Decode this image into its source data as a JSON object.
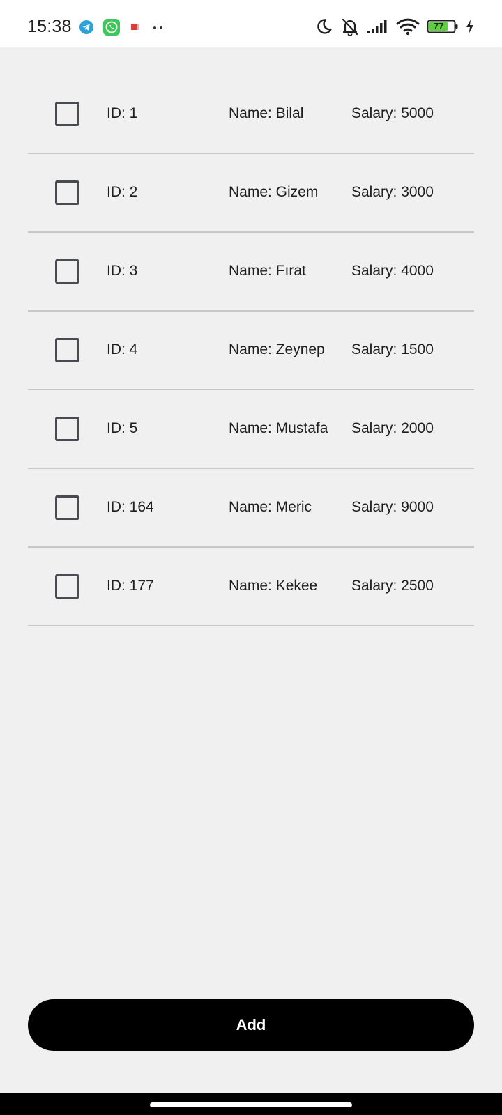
{
  "status_bar": {
    "time": "15:38",
    "left_icons": [
      "telegram-icon",
      "whatsapp-icon",
      "notification-icon",
      "more-dots-icon"
    ],
    "right_icons": [
      "moon-icon",
      "bell-off-icon",
      "signal-icon",
      "wifi-icon",
      "battery-icon",
      "charging-icon"
    ],
    "battery_level": "77"
  },
  "employees": [
    {
      "id": "ID: 1",
      "name": "Name: Bilal",
      "salary": "Salary: 5000",
      "checked": false
    },
    {
      "id": "ID: 2",
      "name": "Name: Gizem",
      "salary": "Salary: 3000",
      "checked": false
    },
    {
      "id": "ID: 3",
      "name": "Name: Fırat",
      "salary": "Salary: 4000",
      "checked": false
    },
    {
      "id": "ID: 4",
      "name": "Name: Zeynep",
      "salary": "Salary: 1500",
      "checked": false
    },
    {
      "id": "ID: 5",
      "name": "Name: Mustafa",
      "salary": "Salary: 2000",
      "checked": false
    },
    {
      "id": "ID: 164",
      "name": "Name: Meric",
      "salary": "Salary: 9000",
      "checked": false
    },
    {
      "id": "ID: 177",
      "name": "Name: Kekee",
      "salary": "Salary: 2500",
      "checked": false
    }
  ],
  "add_button": {
    "label": "Add"
  },
  "colors": {
    "background": "#f0f0f0",
    "button": "#000000",
    "button_text": "#ffffff",
    "divider": "#c8c8c8",
    "checkbox_border": "#4a4a52",
    "battery_fill": "#5bd23c"
  }
}
